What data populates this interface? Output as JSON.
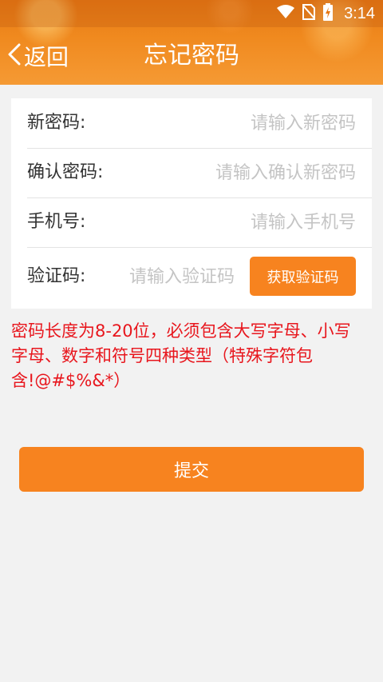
{
  "status_bar": {
    "time": "3:14",
    "icons": [
      "wifi-icon",
      "no-sim-icon",
      "battery-charging-icon"
    ]
  },
  "header": {
    "back_label": "返回",
    "title": "忘记密码"
  },
  "form": {
    "new_password": {
      "label": "新密码:",
      "placeholder": "请输入新密码",
      "value": ""
    },
    "confirm_password": {
      "label": "确认密码:",
      "placeholder": "请输入确认新密码",
      "value": ""
    },
    "phone": {
      "label": "手机号:",
      "placeholder": "请输入手机号",
      "value": ""
    },
    "verification_code": {
      "label": "验证码:",
      "placeholder": "请输入验证码",
      "value": "",
      "button_label": "获取验证码"
    }
  },
  "hint": "密码长度为8-20位，必须包含大写字母、小写字母、数字和符号四种类型（特殊字符包含!@#$%&*）",
  "submit_label": "提交",
  "colors": {
    "accent": "#f7831f",
    "hint_red": "#e8161d",
    "header_orange": "#f08a1f",
    "background": "#f2f2f2"
  }
}
